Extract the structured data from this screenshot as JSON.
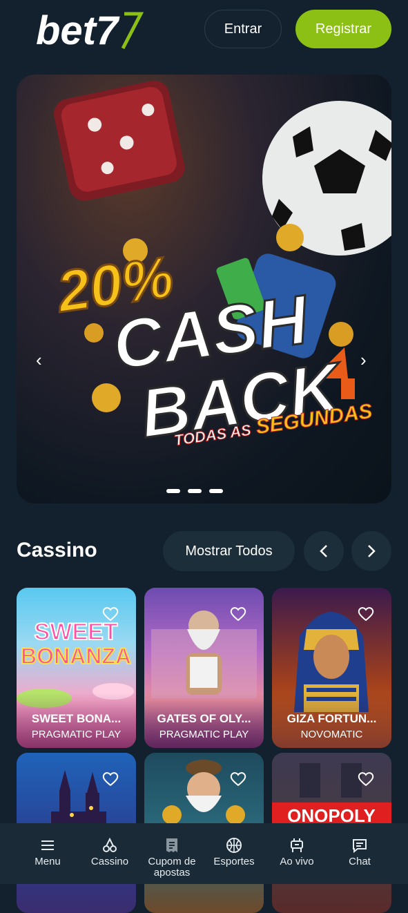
{
  "header": {
    "logo_text": "bet7",
    "login_label": "Entrar",
    "register_label": "Registrar",
    "accent_color": "#8cc014"
  },
  "banner": {
    "percent": "20%",
    "line1": "CASH",
    "line2": "BACK",
    "subtitle_a": "TODAS AS",
    "subtitle_b": "SEGUNDAS",
    "slide_count": 3,
    "active_slide": 1
  },
  "casino": {
    "title": "Cassino",
    "show_all_label": "Mostrar Todos",
    "games": [
      {
        "name": "SWEET BONA...",
        "provider": "PRAGMATIC PLAY",
        "logo_a": "SWEET",
        "logo_b": "BONANZA"
      },
      {
        "name": "GATES OF OLY...",
        "provider": "PRAGMATIC PLAY"
      },
      {
        "name": "GIZA FORTUN...",
        "provider": "NOVOMATIC"
      },
      {
        "name": "",
        "provider": ""
      },
      {
        "name": "",
        "provider": ""
      },
      {
        "name": "",
        "provider": "",
        "logo_text": "ONOPOLY"
      }
    ]
  },
  "bottom_nav": [
    {
      "label": "Menu",
      "icon": "menu-icon"
    },
    {
      "label": "Cassino",
      "icon": "cherries-icon"
    },
    {
      "label": "Cupom de apostas",
      "icon": "betslip-icon"
    },
    {
      "label": "Esportes",
      "icon": "basketball-icon"
    },
    {
      "label": "Ao vivo",
      "icon": "live-icon"
    },
    {
      "label": "Chat",
      "icon": "chat-icon"
    }
  ]
}
